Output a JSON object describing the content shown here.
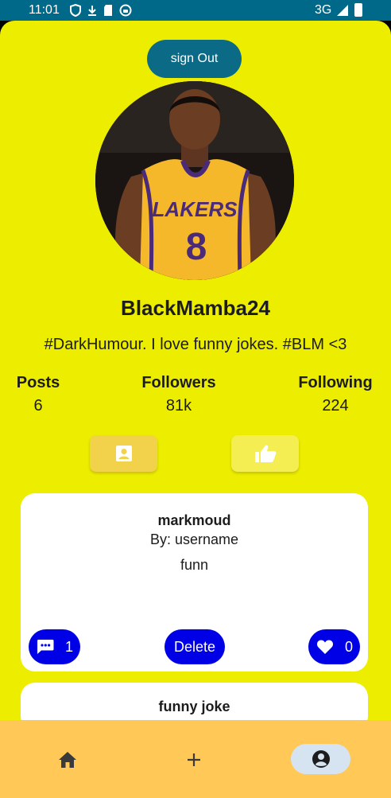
{
  "status_bar": {
    "time": "11:01",
    "network": "3G"
  },
  "header": {
    "signout_label": "sign Out"
  },
  "profile": {
    "username": "BlackMamba24",
    "bio": "#DarkHumour. I love funny jokes. #BLM <3",
    "avatar_jersey_text": "LAKERS",
    "avatar_jersey_number": "8",
    "stats": {
      "posts_label": "Posts",
      "posts_value": "6",
      "followers_label": "Followers",
      "followers_value": "81k",
      "following_label": "Following",
      "following_value": "224"
    }
  },
  "tabs": {
    "posts_icon": "portrait-icon",
    "liked_icon": "thumbs-up-icon"
  },
  "posts": [
    {
      "title": "markmoud",
      "author": "By: username",
      "body": "funn",
      "comment_count": "1",
      "delete_label": "Delete",
      "like_count": "0"
    },
    {
      "title": "funny joke"
    }
  ],
  "bottom_nav": {
    "items": [
      "home-icon",
      "add-icon",
      "profile-icon"
    ],
    "active": "profile-icon"
  },
  "colors": {
    "background": "#eded00",
    "primary": "#0b6b86",
    "action_blue": "#0000e6",
    "nav_bar": "#ffc857"
  }
}
